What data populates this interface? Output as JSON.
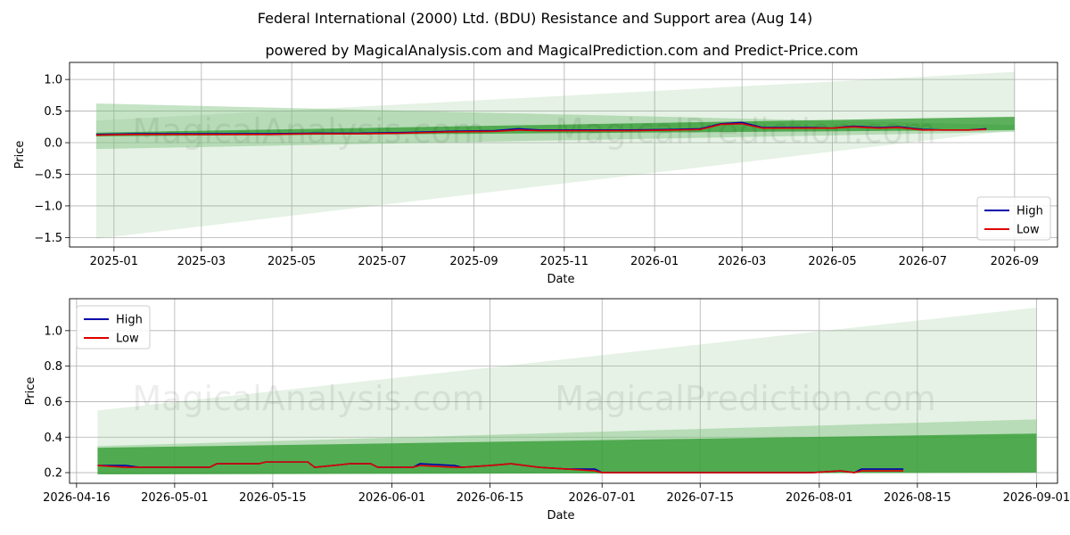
{
  "title": "Federal International (2000) Ltd. (BDU) Resistance and Support area (Aug 14)",
  "subtitle": "powered by MagicalAnalysis.com and MagicalPrediction.com and Predict-Price.com",
  "watermarks": [
    "MagicalAnalysis.com",
    "MagicalPrediction.com"
  ],
  "colors": {
    "high": "#0000aa",
    "low": "#dd0000",
    "band_dark": "#2e9a2e",
    "band_light": "#7fc07f"
  },
  "chart_data": [
    {
      "type": "line",
      "xlabel": "Date",
      "ylabel": "Price",
      "x_range": [
        "2024-12-02",
        "2026-09-30"
      ],
      "ylim": [
        -1.65,
        1.27
      ],
      "x_ticks": [
        "2025-01-01",
        "2025-03-01",
        "2025-05-01",
        "2025-07-01",
        "2025-09-01",
        "2025-11-01",
        "2026-01-01",
        "2026-03-01",
        "2026-05-01",
        "2026-07-01",
        "2026-09-01"
      ],
      "x_tick_labels": [
        "2025-01",
        "2025-03",
        "2025-05",
        "2025-07",
        "2025-09",
        "2025-11",
        "2026-01",
        "2026-03",
        "2026-05",
        "2026-07",
        "2026-09"
      ],
      "y_ticks": [
        1.0,
        0.5,
        0.0,
        -0.5,
        -1.0,
        -1.5
      ],
      "y_tick_labels": [
        "1.0",
        "0.5",
        "0.0",
        "−0.5",
        "−1.0",
        "−1.5"
      ],
      "grid": true,
      "legend": "bottom-right",
      "bands": [
        {
          "x": [
            "2024-12-20",
            "2026-09-01"
          ],
          "upper": [
            0.62,
            0.28
          ],
          "lower": [
            -0.1,
            0.17
          ],
          "shade": "medium"
        },
        {
          "x": [
            "2024-12-20",
            "2026-09-01"
          ],
          "upper": [
            0.35,
            1.12
          ],
          "lower": [
            -1.52,
            0.2
          ],
          "shade": "light"
        },
        {
          "x": [
            "2024-12-20",
            "2026-09-01"
          ],
          "upper": [
            0.16,
            0.41
          ],
          "lower": [
            0.1,
            0.2
          ],
          "shade": "dark"
        }
      ],
      "series": [
        {
          "name": "High",
          "color": "#0000aa",
          "x": [
            "2024-12-20",
            "2025-01-15",
            "2025-02-15",
            "2025-03-15",
            "2025-04-15",
            "2025-05-15",
            "2025-06-15",
            "2025-07-15",
            "2025-08-15",
            "2025-09-15",
            "2025-10-01",
            "2025-10-15",
            "2025-11-15",
            "2025-12-15",
            "2026-01-15",
            "2026-02-01",
            "2026-02-15",
            "2026-03-01",
            "2026-03-15",
            "2026-04-01",
            "2026-04-15",
            "2026-05-01",
            "2026-05-15",
            "2026-06-01",
            "2026-06-15",
            "2026-07-01",
            "2026-07-15",
            "2026-08-01",
            "2026-08-13"
          ],
          "y": [
            0.13,
            0.14,
            0.14,
            0.14,
            0.14,
            0.15,
            0.15,
            0.16,
            0.18,
            0.19,
            0.22,
            0.2,
            0.2,
            0.2,
            0.21,
            0.22,
            0.3,
            0.32,
            0.24,
            0.24,
            0.24,
            0.23,
            0.26,
            0.24,
            0.25,
            0.21,
            0.2,
            0.2,
            0.22
          ]
        },
        {
          "name": "Low",
          "color": "#dd0000",
          "x": [
            "2024-12-20",
            "2025-01-15",
            "2025-02-15",
            "2025-03-15",
            "2025-04-15",
            "2025-05-15",
            "2025-06-15",
            "2025-07-15",
            "2025-08-15",
            "2025-09-15",
            "2025-10-01",
            "2025-10-15",
            "2025-11-15",
            "2025-12-15",
            "2026-01-15",
            "2026-02-01",
            "2026-02-15",
            "2026-03-01",
            "2026-03-15",
            "2026-04-01",
            "2026-04-15",
            "2026-05-01",
            "2026-05-15",
            "2026-06-01",
            "2026-06-15",
            "2026-07-01",
            "2026-07-15",
            "2026-08-01",
            "2026-08-13"
          ],
          "y": [
            0.12,
            0.13,
            0.13,
            0.13,
            0.13,
            0.14,
            0.14,
            0.15,
            0.17,
            0.18,
            0.2,
            0.19,
            0.19,
            0.19,
            0.2,
            0.21,
            0.29,
            0.3,
            0.23,
            0.23,
            0.23,
            0.23,
            0.25,
            0.23,
            0.24,
            0.2,
            0.2,
            0.2,
            0.21
          ]
        }
      ]
    },
    {
      "type": "line",
      "xlabel": "Date",
      "ylabel": "Price",
      "x_range": [
        "2026-04-16",
        "2026-09-04"
      ],
      "ylim": [
        0.14,
        1.18
      ],
      "x_ticks": [
        "2026-04-17",
        "2026-05-01",
        "2026-05-15",
        "2026-06-01",
        "2026-06-15",
        "2026-07-01",
        "2026-07-15",
        "2026-08-01",
        "2026-08-15",
        "2026-09-01"
      ],
      "x_tick_labels": [
        "2026-04-16",
        "2026-05-01",
        "2026-05-15",
        "2026-06-01",
        "2026-06-15",
        "2026-07-01",
        "2026-07-15",
        "2026-08-01",
        "2026-08-15",
        "2026-09-01"
      ],
      "y_ticks": [
        1.0,
        0.8,
        0.6,
        0.4,
        0.2
      ],
      "y_tick_labels": [
        "1.0",
        "0.8",
        "0.6",
        "0.4",
        "0.2"
      ],
      "grid": true,
      "legend": "top-left",
      "bands": [
        {
          "x": [
            "2026-04-20",
            "2026-09-01"
          ],
          "upper": [
            0.55,
            1.13
          ],
          "lower": [
            0.2,
            0.2
          ],
          "shade": "light"
        },
        {
          "x": [
            "2026-04-20",
            "2026-09-01"
          ],
          "upper": [
            0.35,
            0.5
          ],
          "lower": [
            0.19,
            0.2
          ],
          "shade": "medium"
        },
        {
          "x": [
            "2026-04-20",
            "2026-09-01"
          ],
          "upper": [
            0.34,
            0.42
          ],
          "lower": [
            0.19,
            0.2
          ],
          "shade": "dark"
        }
      ],
      "series": [
        {
          "name": "High",
          "color": "#0000aa",
          "x": [
            "2026-04-20",
            "2026-04-24",
            "2026-04-26",
            "2026-05-01",
            "2026-05-06",
            "2026-05-07",
            "2026-05-13",
            "2026-05-14",
            "2026-05-20",
            "2026-05-21",
            "2026-05-26",
            "2026-05-29",
            "2026-05-30",
            "2026-06-04",
            "2026-06-05",
            "2026-06-10",
            "2026-06-11",
            "2026-06-15",
            "2026-06-18",
            "2026-06-22",
            "2026-06-26",
            "2026-06-30",
            "2026-07-01",
            "2026-07-05",
            "2026-07-15",
            "2026-07-31",
            "2026-08-04",
            "2026-08-06",
            "2026-08-07",
            "2026-08-13"
          ],
          "y": [
            0.24,
            0.24,
            0.23,
            0.23,
            0.23,
            0.25,
            0.25,
            0.26,
            0.26,
            0.23,
            0.25,
            0.25,
            0.23,
            0.23,
            0.25,
            0.24,
            0.23,
            0.24,
            0.25,
            0.23,
            0.22,
            0.22,
            0.2,
            0.2,
            0.2,
            0.2,
            0.21,
            0.2,
            0.22,
            0.22
          ]
        },
        {
          "name": "Low",
          "color": "#dd0000",
          "x": [
            "2026-04-20",
            "2026-04-24",
            "2026-04-26",
            "2026-05-01",
            "2026-05-06",
            "2026-05-07",
            "2026-05-13",
            "2026-05-14",
            "2026-05-20",
            "2026-05-21",
            "2026-05-26",
            "2026-05-29",
            "2026-05-30",
            "2026-06-04",
            "2026-06-05",
            "2026-06-10",
            "2026-06-11",
            "2026-06-15",
            "2026-06-18",
            "2026-06-22",
            "2026-06-26",
            "2026-06-30",
            "2026-07-01",
            "2026-07-05",
            "2026-07-15",
            "2026-07-31",
            "2026-08-04",
            "2026-08-06",
            "2026-08-07",
            "2026-08-13"
          ],
          "y": [
            0.24,
            0.23,
            0.23,
            0.23,
            0.23,
            0.25,
            0.25,
            0.26,
            0.26,
            0.23,
            0.25,
            0.25,
            0.23,
            0.23,
            0.24,
            0.23,
            0.23,
            0.24,
            0.25,
            0.23,
            0.22,
            0.21,
            0.2,
            0.2,
            0.2,
            0.2,
            0.21,
            0.2,
            0.21,
            0.21
          ]
        }
      ]
    }
  ]
}
